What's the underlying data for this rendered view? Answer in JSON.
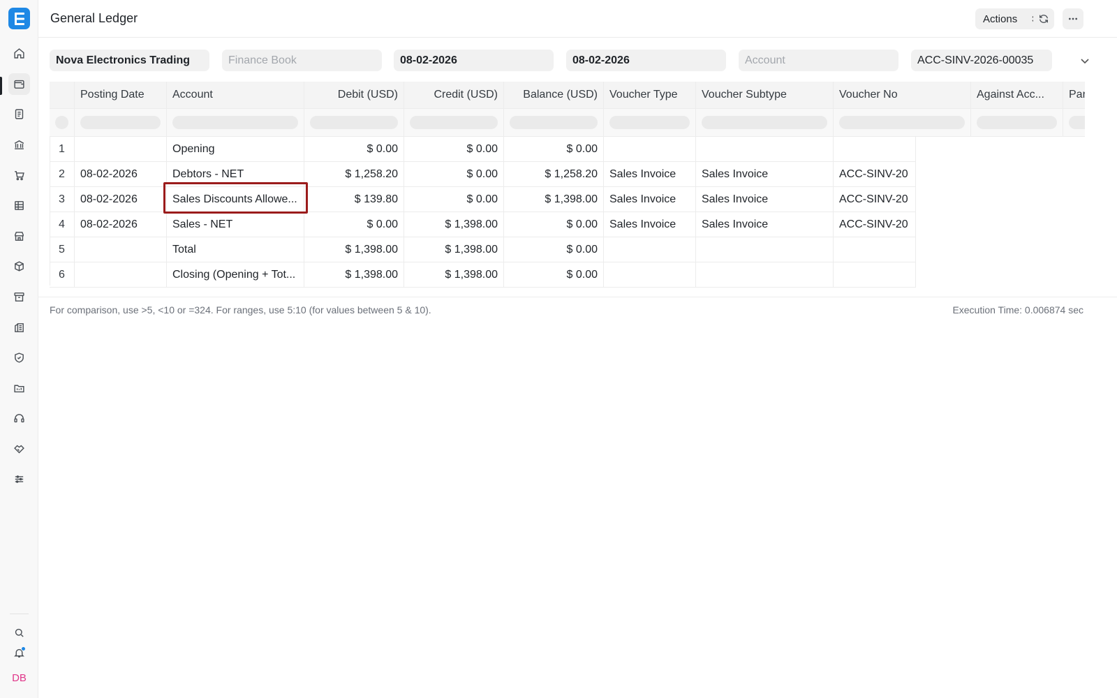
{
  "app": {
    "logo_letter": "E",
    "user_initials": "DB"
  },
  "header": {
    "title": "General Ledger",
    "actions_label": "Actions"
  },
  "filters": {
    "company": "Nova Electronics Trading",
    "finance_book_placeholder": "Finance Book",
    "from_date": "08-02-2026",
    "to_date": "08-02-2026",
    "account_placeholder": "Account",
    "voucher_no": "ACC-SINV-2026-00035"
  },
  "table": {
    "columns": [
      "Posting Date",
      "Account",
      "Debit (USD)",
      "Credit (USD)",
      "Balance (USD)",
      "Voucher Type",
      "Voucher Subtype",
      "Voucher No",
      "Against Acc...",
      "Par"
    ],
    "rows": [
      {
        "idx": "1",
        "posting_date": "",
        "account": "Opening",
        "debit": "$ 0.00",
        "credit": "$ 0.00",
        "balance": "$ 0.00",
        "voucher_type": "",
        "voucher_subtype": "",
        "voucher_no": ""
      },
      {
        "idx": "2",
        "posting_date": "08-02-2026",
        "account": "Debtors - NET",
        "debit": "$ 1,258.20",
        "credit": "$ 0.00",
        "balance": "$ 1,258.20",
        "voucher_type": "Sales Invoice",
        "voucher_subtype": "Sales Invoice",
        "voucher_no": "ACC-SINV-20"
      },
      {
        "idx": "3",
        "posting_date": "08-02-2026",
        "account": "Sales Discounts Allowe...",
        "debit": "$ 139.80",
        "credit": "$ 0.00",
        "balance": "$ 1,398.00",
        "voucher_type": "Sales Invoice",
        "voucher_subtype": "Sales Invoice",
        "voucher_no": "ACC-SINV-20"
      },
      {
        "idx": "4",
        "posting_date": "08-02-2026",
        "account": "Sales - NET",
        "debit": "$ 0.00",
        "credit": "$ 1,398.00",
        "balance": "$ 0.00",
        "voucher_type": "Sales Invoice",
        "voucher_subtype": "Sales Invoice",
        "voucher_no": "ACC-SINV-20"
      },
      {
        "idx": "5",
        "posting_date": "",
        "account": "Total",
        "debit": "$ 1,398.00",
        "credit": "$ 1,398.00",
        "balance": "$ 0.00",
        "voucher_type": "",
        "voucher_subtype": "",
        "voucher_no": ""
      },
      {
        "idx": "6",
        "posting_date": "",
        "account": "Closing (Opening + Tot...",
        "debit": "$ 1,398.00",
        "credit": "$ 1,398.00",
        "balance": "$ 0.00",
        "voucher_type": "",
        "voucher_subtype": "",
        "voucher_no": ""
      }
    ]
  },
  "footer": {
    "hint": "For comparison, use >5, <10 or =324. For ranges, use 5:10 (for values between 5 & 10).",
    "execution_time": "Execution Time: 0.006874 sec"
  },
  "colors": {
    "accent": "#1e88e5",
    "highlight_border": "#9b1c1c",
    "avatar_text": "#e0378a"
  },
  "icons": [
    "home-icon",
    "wallet-icon",
    "document-icon",
    "bank-icon",
    "cart-icon",
    "table-icon",
    "store-icon",
    "package-icon",
    "archive-icon",
    "building-icon",
    "shield-icon",
    "folder-icon",
    "headset-icon",
    "handshake-icon",
    "sliders-icon",
    "search-icon",
    "bell-icon",
    "refresh-icon",
    "more-icon",
    "chevron-down-icon"
  ]
}
